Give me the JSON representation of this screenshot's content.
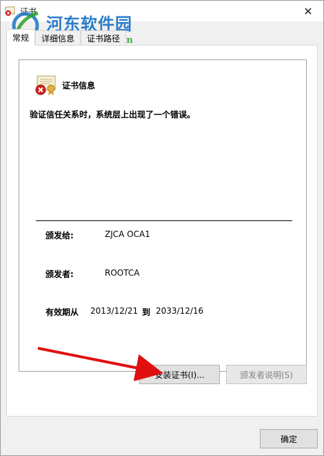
{
  "window": {
    "title": "证书",
    "close_glyph": "✕"
  },
  "watermark": {
    "brand": "河东软件园",
    "url": "www.pc0359.cn"
  },
  "tabs": [
    {
      "label": "常规",
      "active": true
    },
    {
      "label": "详细信息",
      "active": false
    },
    {
      "label": "证书路径",
      "active": false
    }
  ],
  "cert": {
    "info_title": "证书信息",
    "error_message": "验证信任关系时，系统层上出现了一个错误。",
    "issued_to_label": "颁发给:",
    "issued_to_value": "ZJCA OCA1",
    "issued_by_label": "颁发者:",
    "issued_by_value": "ROOTCA",
    "validity_label": "有效期从",
    "valid_from": "2013/12/21",
    "validity_to_label": "到",
    "valid_to": "2033/12/16"
  },
  "buttons": {
    "install": "安装证书(I)...",
    "issuer_statement": "颁发者说明(S)",
    "ok": "确定"
  },
  "colors": {
    "watermark_blue": "#1a73c8",
    "watermark_green": "#2aa12a",
    "arrow_red": "#e01010",
    "error_red": "#d32020"
  },
  "icons": {
    "title": "certificate-error-icon",
    "cert": "certificate-error-icon",
    "close": "close-icon"
  }
}
